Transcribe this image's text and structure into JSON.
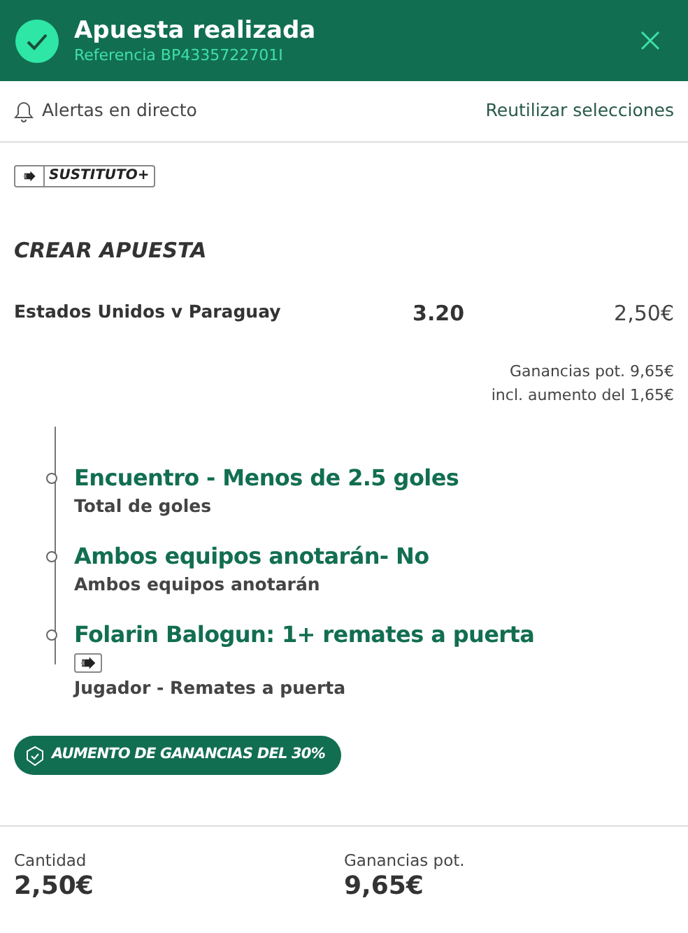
{
  "header": {
    "title": "Apuesta realizada",
    "reference": "Referencia BP4335722701I"
  },
  "toolbar": {
    "alerts": "Alertas en directo",
    "reuse": "Reutilizar selecciones"
  },
  "badge": "SUSTITUTO+",
  "section_title": "CREAR APUESTA",
  "bet": {
    "event": "Estados Unidos v Paraguay",
    "odds": "3.20",
    "stake": "2,50€",
    "returns": "Ganancias pot. 9,65€",
    "boost_note": "incl. aumento del 1,65€"
  },
  "selections": [
    {
      "name": "Encuentro - Menos de 2.5 goles",
      "market": "Total de goles",
      "substitute": false
    },
    {
      "name": "Ambos equipos anotarán- No",
      "market": "Ambos equipos anotarán",
      "substitute": false
    },
    {
      "name": "Folarin Balogun: 1+ remates a puerta",
      "market": "Jugador - Remates a puerta",
      "substitute": true
    }
  ],
  "boost": "AUMENTO DE GANANCIAS DEL 30%",
  "footer": [
    {
      "label": "Cantidad",
      "value": "2,50€"
    },
    {
      "label": "Ganancias pot.",
      "value": "9,65€"
    }
  ]
}
